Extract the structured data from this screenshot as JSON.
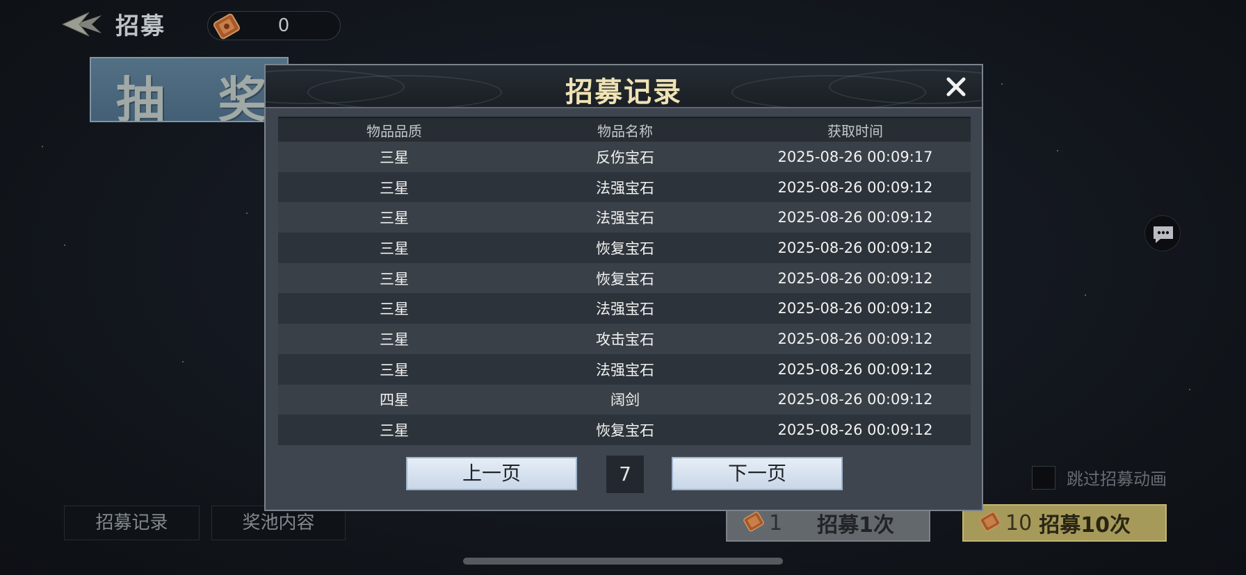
{
  "top_bar": {
    "title": "招募",
    "currency_value": "0"
  },
  "banner": {
    "text": "抽 奖"
  },
  "bottom_left": {
    "records_label": "招募记录",
    "pool_label": "奖池内容"
  },
  "skip_animation": {
    "label": "跳过招募动画",
    "checked": false
  },
  "recruit_one": {
    "count": "1",
    "label": "招募1次"
  },
  "recruit_ten": {
    "count": "10",
    "label": "招募10次"
  },
  "modal": {
    "title": "招募记录",
    "columns": [
      "物品品质",
      "物品名称",
      "获取时间"
    ],
    "rows": [
      {
        "quality": "三星",
        "name": "反伤宝石",
        "time": "2025-08-26 00:09:17"
      },
      {
        "quality": "三星",
        "name": "法强宝石",
        "time": "2025-08-26 00:09:12"
      },
      {
        "quality": "三星",
        "name": "法强宝石",
        "time": "2025-08-26 00:09:12"
      },
      {
        "quality": "三星",
        "name": "恢复宝石",
        "time": "2025-08-26 00:09:12"
      },
      {
        "quality": "三星",
        "name": "恢复宝石",
        "time": "2025-08-26 00:09:12"
      },
      {
        "quality": "三星",
        "name": "法强宝石",
        "time": "2025-08-26 00:09:12"
      },
      {
        "quality": "三星",
        "name": "攻击宝石",
        "time": "2025-08-26 00:09:12"
      },
      {
        "quality": "三星",
        "name": "法强宝石",
        "time": "2025-08-26 00:09:12"
      },
      {
        "quality": "四星",
        "name": "阔剑",
        "time": "2025-08-26 00:09:12"
      },
      {
        "quality": "三星",
        "name": "恢复宝石",
        "time": "2025-08-26 00:09:12"
      }
    ],
    "pagination": {
      "prev_label": "上一页",
      "page": "7",
      "next_label": "下一页"
    }
  },
  "icons": {
    "back": "back-arrow-icon",
    "ticket": "recruit-ticket-icon",
    "close": "close-icon",
    "chat": "chat-bubble-icon"
  },
  "colors": {
    "modal_title": "#efe2b4",
    "recruit_ten_bg": "#b5a862",
    "recruit_one_bg": "#6c7177",
    "page_button_bg": "#dce6f2"
  }
}
